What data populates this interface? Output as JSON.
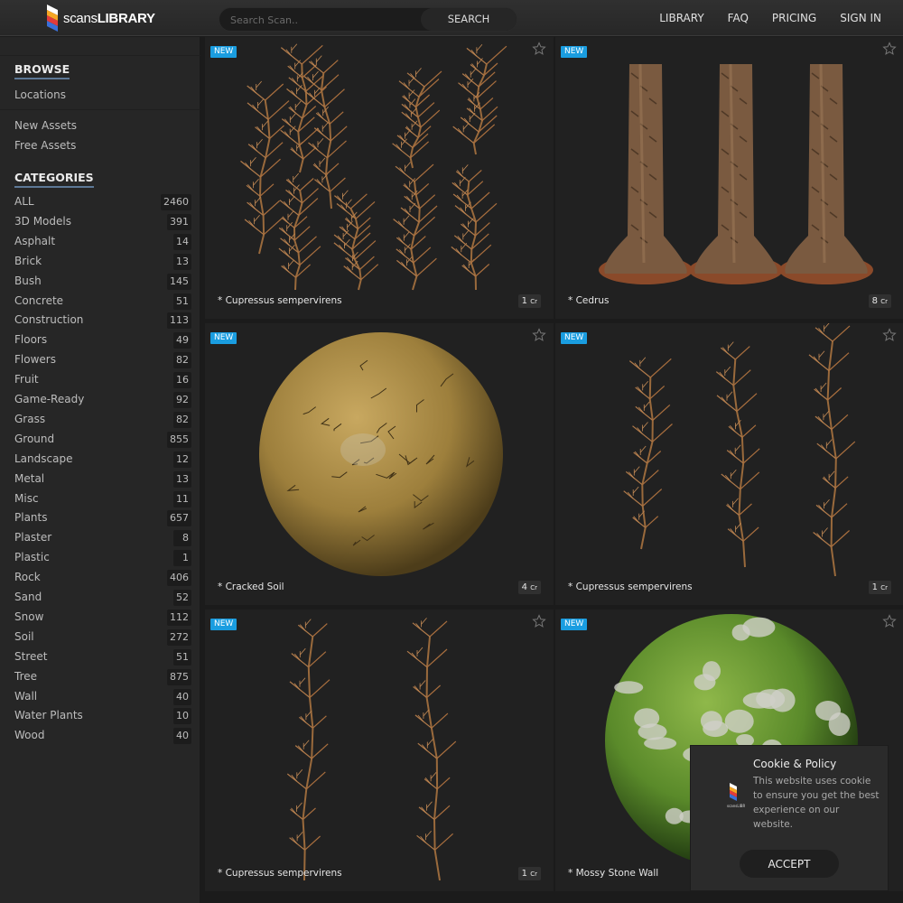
{
  "header": {
    "logo_prefix": "scans",
    "logo_bold": "LIBRARY",
    "search_placeholder": "Search Scan..",
    "search_button": "SEARCH",
    "nav": [
      "LIBRARY",
      "FAQ",
      "PRICING",
      "SIGN IN"
    ]
  },
  "sidebar": {
    "browse_title": "BROWSE",
    "browse_links": [
      "Locations",
      "New Assets",
      "Free Assets"
    ],
    "categories_title": "CATEGORIES",
    "categories": [
      {
        "label": "ALL",
        "count": "2460"
      },
      {
        "label": "3D Models",
        "count": "391"
      },
      {
        "label": "Asphalt",
        "count": "14"
      },
      {
        "label": "Brick",
        "count": "13"
      },
      {
        "label": "Bush",
        "count": "145"
      },
      {
        "label": "Concrete",
        "count": "51"
      },
      {
        "label": "Construction",
        "count": "113"
      },
      {
        "label": "Floors",
        "count": "49"
      },
      {
        "label": "Flowers",
        "count": "82"
      },
      {
        "label": "Fruit",
        "count": "16"
      },
      {
        "label": "Game-Ready",
        "count": "92"
      },
      {
        "label": "Grass",
        "count": "82"
      },
      {
        "label": "Ground",
        "count": "855"
      },
      {
        "label": "Landscape",
        "count": "12"
      },
      {
        "label": "Metal",
        "count": "13"
      },
      {
        "label": "Misc",
        "count": "11"
      },
      {
        "label": "Plants",
        "count": "657"
      },
      {
        "label": "Plaster",
        "count": "8"
      },
      {
        "label": "Plastic",
        "count": "1"
      },
      {
        "label": "Rock",
        "count": "406"
      },
      {
        "label": "Sand",
        "count": "52"
      },
      {
        "label": "Snow",
        "count": "112"
      },
      {
        "label": "Soil",
        "count": "272"
      },
      {
        "label": "Street",
        "count": "51"
      },
      {
        "label": "Tree",
        "count": "875"
      },
      {
        "label": "Wall",
        "count": "40"
      },
      {
        "label": "Water Plants",
        "count": "10"
      },
      {
        "label": "Wood",
        "count": "40"
      }
    ]
  },
  "assets": [
    {
      "badge": "NEW",
      "title": "* Cupressus sempervirens",
      "credits": "1",
      "unit": "Cr",
      "art": "branches"
    },
    {
      "badge": "NEW",
      "title": "* Cedrus",
      "credits": "8",
      "unit": "Cr",
      "art": "trunks"
    },
    {
      "badge": "NEW",
      "title": "* Cracked Soil",
      "credits": "4",
      "unit": "Cr",
      "art": "soil-sphere"
    },
    {
      "badge": "NEW",
      "title": "* Cupressus sempervirens",
      "credits": "1",
      "unit": "Cr",
      "art": "branches"
    },
    {
      "badge": "NEW",
      "title": "* Cupressus sempervirens",
      "credits": "1",
      "unit": "Cr",
      "art": "branches"
    },
    {
      "badge": "NEW",
      "title": "* Mossy Stone Wall",
      "credits": "",
      "unit": "",
      "art": "moss-sphere"
    }
  ],
  "cookie": {
    "title": "Cookie & Policy",
    "text": "This website uses cookie to ensure you get the best experience on our website.",
    "accept": "ACCEPT"
  },
  "colors": {
    "accent": "#1a9de0",
    "header_bg": "#2b2b2b",
    "sidebar_bg": "#262626",
    "card_bg": "#212121",
    "underline": "#5d7896"
  },
  "icons": [
    "logo-mark-icon",
    "star-icon"
  ]
}
